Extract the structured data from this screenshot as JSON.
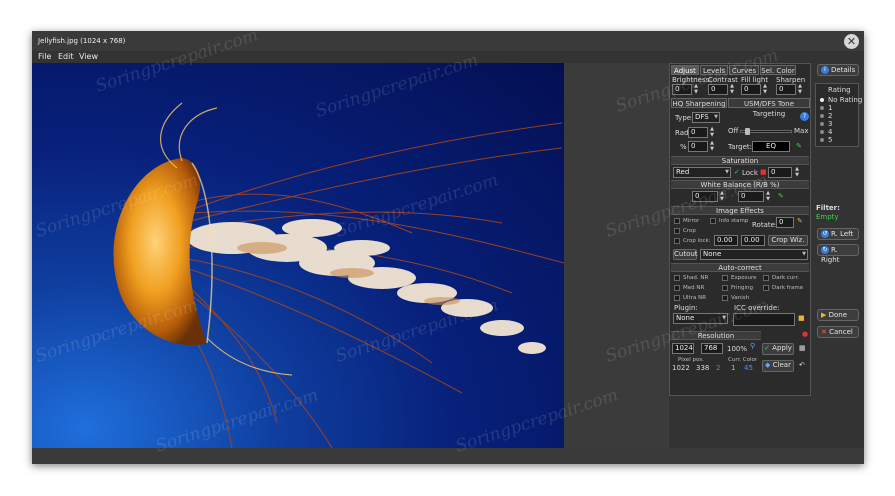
{
  "window": {
    "title": "Jellyfish.jpg (1024 x 768)",
    "close_glyph": "✕"
  },
  "menu": {
    "items": [
      "File",
      "Edit",
      "View"
    ]
  },
  "tabs": [
    "Adjust",
    "Levels",
    "Curves",
    "Sel. Color"
  ],
  "adjust": {
    "labels": [
      "Brightness",
      "Contrast",
      "Fill light",
      "Sharpen"
    ],
    "values": [
      "0",
      "0",
      "0",
      "0"
    ]
  },
  "sharpen_tabs": [
    "HQ Sharpening",
    "USM/DFS Tone Targeting"
  ],
  "sharpening": {
    "type_label": "Type:",
    "type_value": "DFS",
    "rad_label": "Rad",
    "rad_value": "0",
    "pct_label": "%",
    "pct_value": "0",
    "off_label": "Off",
    "max_label": "Max",
    "target_label": "Target:",
    "target_value": "EQ",
    "help_glyph": "?",
    "slider_fraction": 0.1
  },
  "saturation": {
    "header": "Saturation",
    "channel": "Red",
    "lock_label": "Lock",
    "value": "0"
  },
  "white_balance": {
    "header": "White Balance (R/B %)",
    "value_1": "0",
    "value_2": "0"
  },
  "image_effects": {
    "header": "Image Effects",
    "mirror": "Mirror",
    "info_stamp": "Info stamp",
    "rotate_label": "Rotate:",
    "rotate_value": "0",
    "crop": "Crop",
    "crop_lock": "Crop lock:",
    "crop_w": "0.00",
    "crop_h": "0.00",
    "crop_wiz": "Crop Wiz.",
    "cutout_label": "Cutout",
    "cutout_value": "None"
  },
  "auto_correct": {
    "header": "Auto-correct",
    "items": [
      "Shad. NR",
      "Exposure",
      "Dark curr.",
      "Med NR",
      "Fringing",
      "Dark frame",
      "Ultra NR",
      "Vanish"
    ],
    "plugin_label": "Plugin:",
    "plugin_value": "None",
    "icc_label": "ICC override:"
  },
  "resolution": {
    "header": "Resolution",
    "width": "1024",
    "height": "768",
    "percent": "100%",
    "apply": "Apply",
    "clear": "Clear"
  },
  "pixel": {
    "pos_label": "Pixel pos.",
    "x": "1022",
    "y": "338",
    "color_label": "Curr. Color",
    "r": "2",
    "g": "1",
    "b": "45"
  },
  "sidebar": {
    "details": "Details",
    "rating_label": "Rating",
    "rating_options": [
      "No Rating",
      "1",
      "2",
      "3",
      "4",
      "5"
    ],
    "filter_label": "Filter:",
    "filter_value": "Empty",
    "rotate_left": "R. Left",
    "rotate_right": "R. Right",
    "done": "Done",
    "cancel": "Cancel"
  },
  "watermark_text": "Soringpcrepair.com",
  "colors": {
    "accent_blue": "#3a7be0",
    "filter_green": "#3fd04a",
    "lock_red": "#d33",
    "pixel_r": "#ff4d4d",
    "pixel_g": "#4dff4d",
    "pixel_b": "#4d8dff"
  }
}
